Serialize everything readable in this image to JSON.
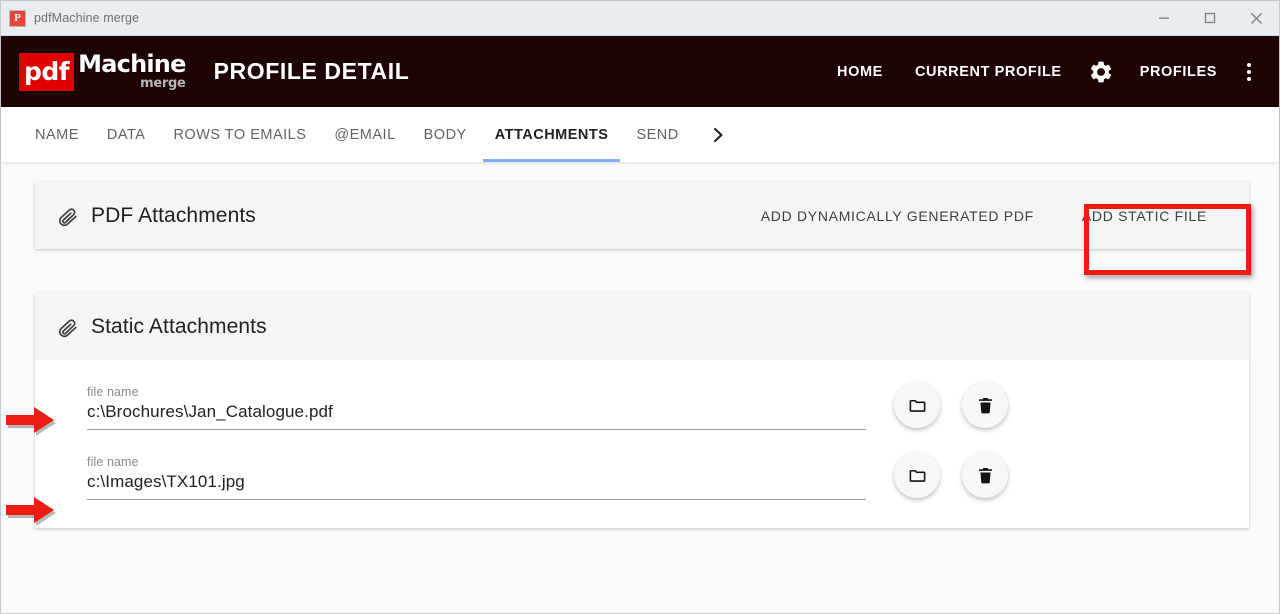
{
  "window": {
    "title": "pdfMachine merge",
    "app_icon": "P",
    "controls": {
      "minimize": "minimize-icon",
      "maximize": "maximize-icon",
      "close": "close-icon"
    }
  },
  "header": {
    "logo": {
      "pdf": "pdf",
      "machine": "Machine",
      "merge": "merge"
    },
    "title": "PROFILE DETAIL",
    "nav": [
      {
        "label": "HOME",
        "name": "nav-home"
      },
      {
        "label": "CURRENT PROFILE",
        "name": "nav-current-profile"
      },
      {
        "label": "PROFILES",
        "name": "nav-profiles"
      }
    ],
    "gear_icon": "gear-icon",
    "overflow_icon": "more-vertical-icon",
    "background_color": "#1d0303"
  },
  "tabs": {
    "items": [
      {
        "label": "NAME",
        "active": false
      },
      {
        "label": "DATA",
        "active": false
      },
      {
        "label": "ROWS TO EMAILS",
        "active": false
      },
      {
        "label": "@EMAIL",
        "active": false
      },
      {
        "label": "BODY",
        "active": false
      },
      {
        "label": "ATTACHMENTS",
        "active": true
      },
      {
        "label": "SEND",
        "active": false
      }
    ],
    "next_icon": "chevron-right-icon",
    "active_underline_color": "#82aefc"
  },
  "pdf_attachments_panel": {
    "icon": "paperclip-icon",
    "title": "PDF Attachments",
    "add_dynamic_label": "ADD DYNAMICALLY GENERATED PDF",
    "add_static_label": "ADD STATIC FILE"
  },
  "static_attachments_panel": {
    "icon": "paperclip-icon",
    "title": "Static Attachments",
    "rows": [
      {
        "label": "file name",
        "value": "c:\\Brochures\\Jan_Catalogue.pdf",
        "browse_icon": "folder-icon",
        "delete_icon": "trash-icon"
      },
      {
        "label": "file name",
        "value": "c:\\Images\\TX101.jpg",
        "browse_icon": "folder-icon",
        "delete_icon": "trash-icon"
      }
    ]
  },
  "annotations": {
    "highlight_color": "#ee1b11",
    "box_target": "ADD STATIC FILE",
    "arrow_targets": [
      "c:\\Brochures\\Jan_Catalogue.pdf",
      "c:\\Images\\TX101.jpg"
    ]
  }
}
